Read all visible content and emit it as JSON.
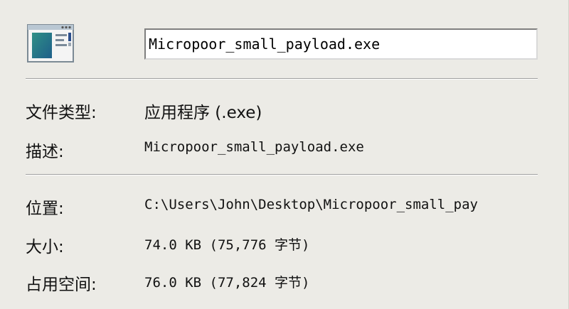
{
  "file": {
    "name": "Micropoor_small_payload.exe",
    "icon": "application-window-icon"
  },
  "properties": [
    {
      "label": "文件类型:",
      "value": "应用程序 (.exe)"
    },
    {
      "label": "描述:",
      "value": "Micropoor_small_payload.exe"
    },
    {
      "label": "位置:",
      "value": "C:\\Users\\John\\Desktop\\Micropoor_small_pay"
    },
    {
      "label": "大小:",
      "value": "74.0 KB (75,776 字节)"
    },
    {
      "label": "占用空间:",
      "value": "76.0 KB (77,824 字节)"
    }
  ],
  "colors": {
    "background": "#ecebe6",
    "separator": "#a0a0a0"
  }
}
